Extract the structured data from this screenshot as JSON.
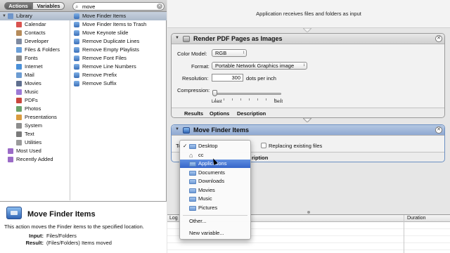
{
  "toolbar": {
    "actions_label": "Actions",
    "variables_label": "Variables",
    "search_value": "move",
    "search_placeholder": "Name"
  },
  "library": {
    "items": [
      {
        "label": "Library",
        "color": "#6f95c9",
        "selected": true,
        "expanded": true
      },
      {
        "label": "Calendar",
        "color": "#d9534f"
      },
      {
        "label": "Contacts",
        "color": "#b68b5a"
      },
      {
        "label": "Developer",
        "color": "#7e8aa0"
      },
      {
        "label": "Files & Folders",
        "color": "#6a9fd8"
      },
      {
        "label": "Fonts",
        "color": "#8a8a8a"
      },
      {
        "label": "Internet",
        "color": "#4a90d9"
      },
      {
        "label": "Mail",
        "color": "#6c9cd2"
      },
      {
        "label": "Movies",
        "color": "#5f6f8f"
      },
      {
        "label": "Music",
        "color": "#9c7ad6"
      },
      {
        "label": "PDFs",
        "color": "#c9463d"
      },
      {
        "label": "Photos",
        "color": "#6aa26a"
      },
      {
        "label": "Presentations",
        "color": "#d99b3f"
      },
      {
        "label": "System",
        "color": "#8d8d8d"
      },
      {
        "label": "Text",
        "color": "#7a7a7a"
      },
      {
        "label": "Utilities",
        "color": "#9a9a9a"
      },
      {
        "label": "Most Used",
        "color": "#9b6bc7",
        "top_level": true
      },
      {
        "label": "Recently Added",
        "color": "#9b6bc7",
        "top_level": true
      }
    ]
  },
  "actions_list": {
    "items": [
      {
        "label": "Move Finder Items",
        "selected": true
      },
      {
        "label": "Move Finder Items to Trash"
      },
      {
        "label": "Move Keynote slide"
      },
      {
        "label": "Remove Duplicate Lines"
      },
      {
        "label": "Remove Empty Playlists"
      },
      {
        "label": "Remove Font Files"
      },
      {
        "label": "Remove Line Numbers"
      },
      {
        "label": "Remove Prefix"
      },
      {
        "label": "Remove Suffix"
      }
    ]
  },
  "description": {
    "title": "Move Finder Items",
    "text": "This action moves the Finder items to the specified location.",
    "input_label": "Input:",
    "input_value": "Files/Folders",
    "result_label": "Result:",
    "result_value": "(Files/Folders) Items moved"
  },
  "workflow": {
    "input_banner": "Application receives files and folders as input",
    "action1": {
      "title": "Render PDF Pages as Images",
      "color_model_label": "Color Model:",
      "color_model_value": "RGB",
      "format_label": "Format:",
      "format_value": "Portable Network Graphics image",
      "resolution_label": "Resolution:",
      "resolution_value": "300",
      "resolution_unit": "dots per inch",
      "compression_label": "Compression:",
      "compression_level": 0.0,
      "least_label": "Least",
      "best_label": "Best",
      "tabs": [
        "Results",
        "Options",
        "Description"
      ]
    },
    "action2": {
      "title": "Move Finder Items",
      "to_label": "To:",
      "replacing_label": "Replacing existing files",
      "replacing_checked": false,
      "tab_visible": "ription"
    }
  },
  "log": {
    "col_log": "Log",
    "col_duration": "Duration"
  },
  "menu": {
    "items": [
      {
        "label": "Desktop",
        "checked": true,
        "icon": "folder-icon"
      },
      {
        "label": "cc",
        "icon": "home-icon"
      },
      {
        "label": "Applications",
        "icon": "folder-icon",
        "highlighted": true
      },
      {
        "label": "Documents",
        "icon": "folder-icon"
      },
      {
        "label": "Downloads",
        "icon": "folder-icon"
      },
      {
        "label": "Movies",
        "icon": "folder-icon"
      },
      {
        "label": "Music",
        "icon": "folder-icon"
      },
      {
        "label": "Pictures",
        "icon": "folder-icon"
      }
    ],
    "other_label": "Other...",
    "new_variable_label": "New variable..."
  },
  "colors": {
    "selection": "#3666c9",
    "action_blue": "#8fa9d2"
  }
}
